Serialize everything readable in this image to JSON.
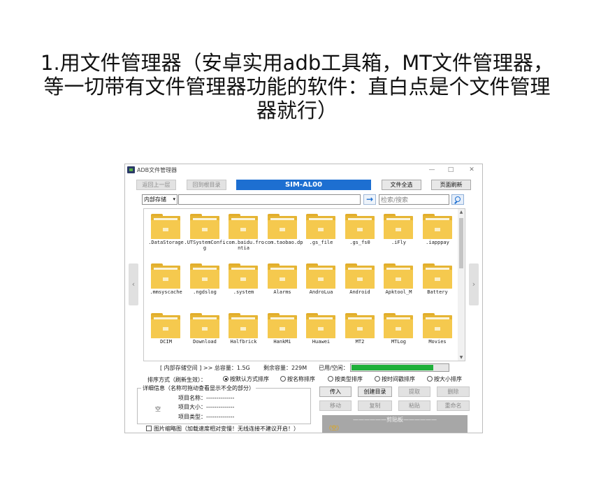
{
  "heading": {
    "line1": "1.用文件管理器（安卓实用adb工具箱，MT文件管理器，",
    "line2": "等一切带有文件管理器功能的软件：直白点是个文件管理",
    "line3": "器就行）"
  },
  "window": {
    "title": "ADB文件管理器",
    "controls": {
      "minimize": "—",
      "maximize": "□",
      "close": "✕"
    }
  },
  "toolbar": {
    "back": "返回上一层",
    "root": "回到根目录",
    "device": "SIM-AL00",
    "select_all": "文件全选",
    "refresh": "页面刷新"
  },
  "pathbar": {
    "storage": "内部存储",
    "path": "",
    "go_icon": "arrow-right-icon",
    "search_placeholder": "检索/搜索"
  },
  "nav": {
    "prev": "‹",
    "next": "›"
  },
  "files": [
    ".DataStorage",
    ".UTSystemConfig",
    ".com.baidu.frontia",
    ".com.taobao.dp",
    ".gs_file",
    ".gs_fs0",
    ".iFly",
    ".iapppay",
    ".mmsyscache",
    ".ngdslog",
    ".system",
    "Alarms",
    "AndroLua",
    "Android",
    "Apktool_M",
    "Battery",
    "DCIM",
    "Download",
    "Halfbrick",
    "HankMi",
    "Huawei",
    "MT2",
    "MTLog",
    "Movies"
  ],
  "status": {
    "space_label": "[ 内部存储空间 ] >>  总容量：1.5G",
    "free_label": "剩余容量：229M",
    "used_label": "已用/空闲：",
    "used_fraction": 0.85,
    "bar_color": "#1fb03a"
  },
  "sort": {
    "label": "排序方式（刷新生效）：",
    "options": [
      "按默认方式排序",
      "按名称排序",
      "按类型排序",
      "按时间戳排序",
      "按大小排序"
    ],
    "selected": 0
  },
  "details": {
    "legend": "详细信息（名称可拖动查看显示不全的部分）",
    "empty": "空",
    "name_label": "项目名称：",
    "name_value": "--------------",
    "size_label": "项目大小：",
    "size_value": "--------------",
    "type_label": "项目类型：",
    "type_value": "--------------"
  },
  "actions": {
    "upload": "传入",
    "mkdir": "创建目录",
    "extract": "提取",
    "delete": "删除",
    "move": "移动",
    "copy": "复制",
    "paste": "粘贴",
    "rename": "重命名"
  },
  "thumbnail_option": "图片缩略图（加载速度相对变慢！无线连接不建议开启！）",
  "clipboard": {
    "title": "——————剪贴板——————",
    "empty": "（空）"
  }
}
